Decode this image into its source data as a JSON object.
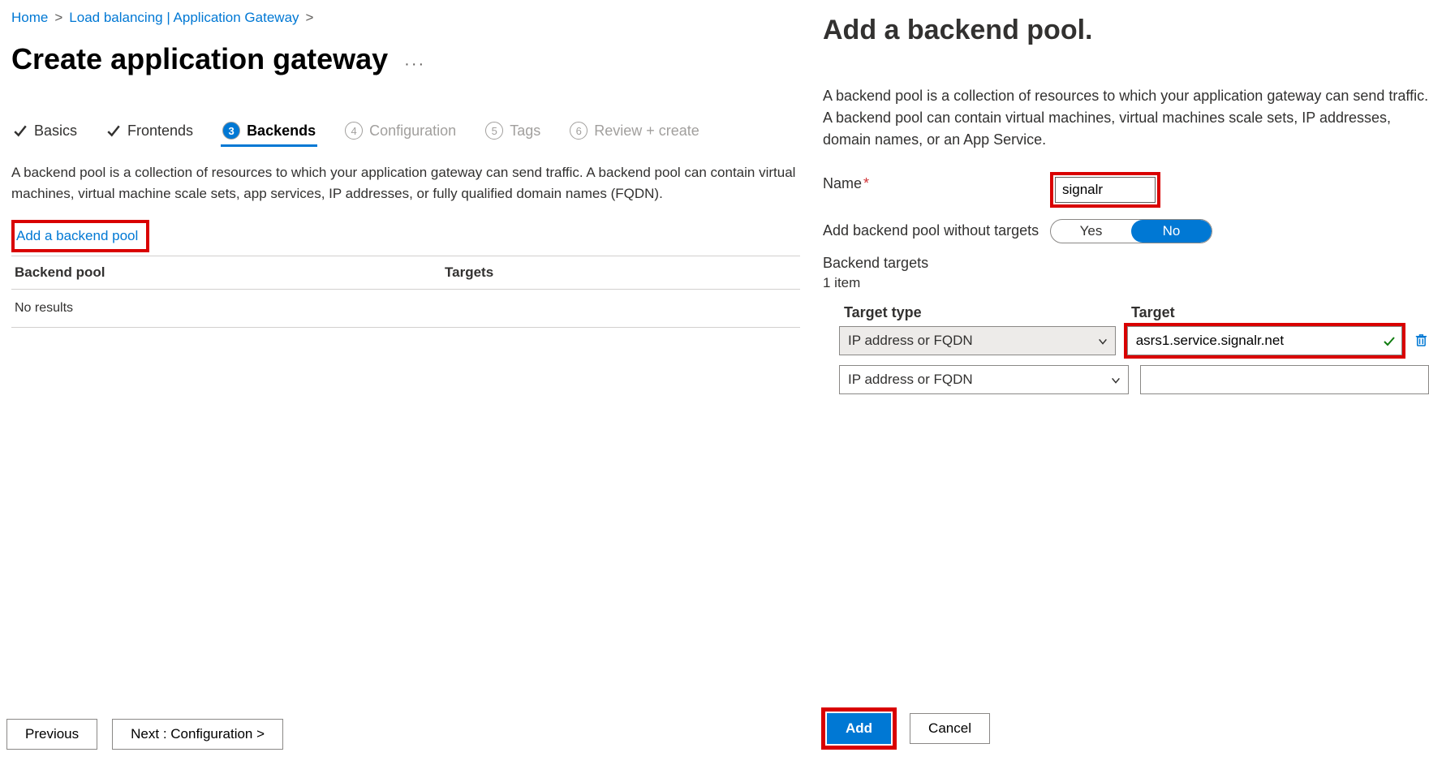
{
  "breadcrumb": {
    "home": "Home",
    "load_balancing": "Load balancing | Application Gateway"
  },
  "page_title": "Create application gateway",
  "tabs": {
    "basics": "Basics",
    "frontends": "Frontends",
    "backends": "Backends",
    "configuration": "Configuration",
    "tags": "Tags",
    "review": "Review + create",
    "step4": "4",
    "step5": "5",
    "step6": "6"
  },
  "main_desc": "A backend pool is a collection of resources to which your application gateway can send traffic. A backend pool can contain virtual machines, virtual machine scale sets, app services, IP addresses, or fully qualified domain names (FQDN).",
  "add_pool_link": "Add a backend pool",
  "grid": {
    "col_pool": "Backend pool",
    "col_targets": "Targets",
    "no_results": "No results"
  },
  "footer": {
    "previous": "Previous",
    "next": "Next : Configuration >"
  },
  "panel": {
    "title": "Add a backend pool.",
    "desc": "A backend pool is a collection of resources to which your application gateway can send traffic. A backend pool can contain virtual machines, virtual machines scale sets, IP addresses, domain names, or an App Service.",
    "name_label": "Name",
    "name_value": "signalr",
    "without_targets_label": "Add backend pool without targets",
    "toggle_yes": "Yes",
    "toggle_no": "No",
    "backend_targets_label": "Backend targets",
    "item_count": "1 item",
    "col_type": "Target type",
    "col_target": "Target",
    "rows": [
      {
        "type": "IP address or FQDN",
        "target": "asrs1.service.signalr.net"
      },
      {
        "type": "IP address or FQDN",
        "target": ""
      }
    ],
    "add_btn": "Add",
    "cancel_btn": "Cancel"
  }
}
